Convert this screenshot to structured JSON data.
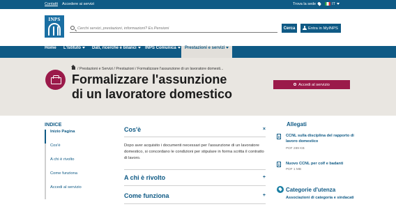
{
  "topbar": {
    "contatti": "Contatti",
    "accedere": "Accedere ai servizi",
    "trova_sede": "Trova la sede",
    "language": "IT"
  },
  "header": {
    "logo_text": "INPS",
    "search_placeholder": "Cerchi servizi, prestazioni, informazioni? Es.Pensioni",
    "search_button": "Cerca",
    "login_button": "Entra in MyINPS"
  },
  "nav": {
    "items": [
      {
        "label": "Home"
      },
      {
        "label": "L'Istituto"
      },
      {
        "label": "Dati, ricerche e bilanci"
      },
      {
        "label": "INPS Comunica"
      },
      {
        "label": "Prestazioni e servizi"
      }
    ]
  },
  "hero": {
    "breadcrumb": "/ Prestazioni e Servizi / Prestazioni / Formalizzare l'assunzione di un lavoratore domesti...",
    "title": "Formalizzare l'assunzione di un lavoratore domestico",
    "cta": "Accedi al servizio"
  },
  "indice": {
    "title": "INDICE",
    "items": [
      {
        "label": "Inizio Pagina"
      },
      {
        "label": "Cos'è"
      },
      {
        "label": "A chi è rivolto"
      },
      {
        "label": "Come funziona"
      },
      {
        "label": "Accedi al servizio"
      }
    ]
  },
  "accordion": {
    "sections": [
      {
        "title": "Cos'è",
        "sign": "×"
      },
      {
        "title": "A chi è rivolto",
        "sign": "+"
      },
      {
        "title": "Come funziona",
        "sign": "+"
      }
    ],
    "body": "Dopo aver acquisito i documenti necessari per l'assunzione di un lavoratore domestico, si concordano le condizioni per stipulare in forma scritta il contratto di lavoro."
  },
  "allegati": {
    "title": "Allegati",
    "items": [
      {
        "title": "CCNL sulla disciplina del rapporto di lavoro domestico",
        "meta": "PDF 289 KB"
      },
      {
        "title": "Nuovo CCNL per colf e badanti",
        "meta": "PDF 1 MB"
      }
    ]
  },
  "categorie": {
    "title": "Categorie d'utenza",
    "sub": "Associazioni di categoria e sindacati"
  }
}
